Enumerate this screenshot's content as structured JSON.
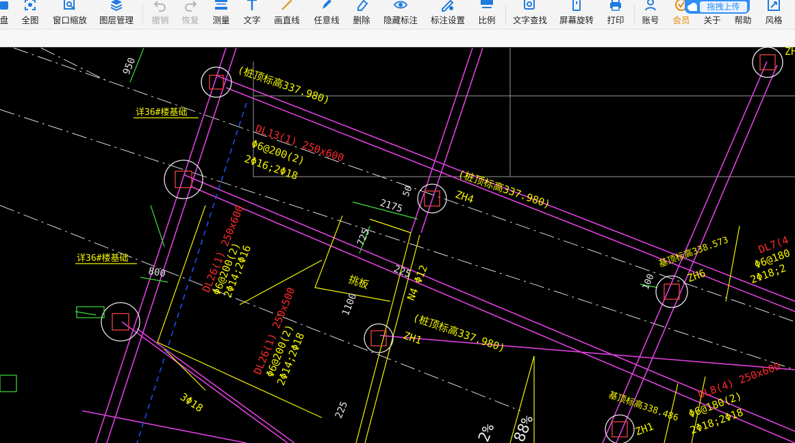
{
  "toolbar": {
    "items": [
      {
        "label": "盘",
        "icon": "disk-icon"
      },
      {
        "label": "全图",
        "icon": "full-view-icon"
      },
      {
        "label": "窗口缩放",
        "icon": "window-zoom-icon"
      },
      {
        "label": "图层管理",
        "icon": "layers-icon"
      },
      {
        "label": "撤销",
        "icon": "undo-icon"
      },
      {
        "label": "恢复",
        "icon": "redo-icon"
      },
      {
        "label": "测量",
        "icon": "measure-icon"
      },
      {
        "label": "文字",
        "icon": "text-icon"
      },
      {
        "label": "画直线",
        "icon": "line-icon"
      },
      {
        "label": "任意线",
        "icon": "freehand-icon"
      },
      {
        "label": "删除",
        "icon": "eraser-icon"
      },
      {
        "label": "隐藏标注",
        "icon": "eye-icon"
      },
      {
        "label": "标注设置",
        "icon": "annotation-settings-icon"
      },
      {
        "label": "比例",
        "icon": "scale-icon"
      },
      {
        "label": "文字查找",
        "icon": "text-search-icon"
      },
      {
        "label": "屏幕旋转",
        "icon": "rotate-icon"
      },
      {
        "label": "打印",
        "icon": "printer-icon"
      },
      {
        "label": "账号",
        "icon": "user-icon"
      },
      {
        "label": "会员",
        "icon": "vip-icon"
      },
      {
        "label": "关于",
        "icon": "about-icon"
      },
      {
        "label": "帮助",
        "icon": "help-icon"
      },
      {
        "label": "风格",
        "icon": "style-icon"
      }
    ],
    "upload_label": "拖拽上传"
  },
  "colors": {
    "accent": "#2f8df5",
    "icon_blue": "#1e7be0",
    "member": "#e58b00",
    "cad_magenta": "#e040e0",
    "cad_yellow": "#f5f500",
    "cad_red": "#ff2a2a",
    "cad_green": "#3ce03c",
    "cad_white": "#e8e8e8"
  },
  "drawing": {
    "pile_top_1": "(桩顶标高337.980)",
    "pile_top_2": "(桩顶标高337.980)",
    "pile_top_3": "(桩顶标高337.980)",
    "zh4": "ZH4",
    "zh1_a": "ZH1",
    "zh6": "ZH6",
    "zh1_b": "ZH1",
    "zh_top": "ZH",
    "beam_dl13": "DL13(1) 250x600",
    "dl13_stirrup": "Φ6@200(2)",
    "dl13_bars": "2Φ16;2Φ18",
    "beam_dl26a": "DL26(1) 250x600",
    "dl26a_stirrup": "Φ6@200(2)",
    "dl26a_bars": "2Φ14;2Φ16",
    "beam_dl26b": "DL26(1) 250x500",
    "dl26b_stirrup": "Φ6@200(2)",
    "dl26b_bars": "2Φ14;2Φ18",
    "beam_dl7": "DL7(4",
    "dl7_stirrup": "Φ6@180",
    "dl7_bars": "2Φ18;2",
    "beam_dl8": "DL8(4) 250x600",
    "dl8_stirrup": "Φ6@180(2)",
    "dl8_bars": "2Φ18;2Φ18",
    "base_elev_1": "基顶标高338.573",
    "base_elev_2": "基顶标高338.486",
    "detail_ref_1": "详36#楼基础",
    "detail_ref_2": "详36#楼基础",
    "slab": "挑板",
    "n4": "N4 Φ12",
    "three_phi18": "3Φ18",
    "dim_950": "950",
    "dim_800": "800",
    "dim_2175": "2175",
    "dim_725": "725",
    "dim_225a": "225",
    "dim_225b": "225",
    "dim_1100": "1100",
    "dim_50": "50",
    "dim_100": "100",
    "pct_2": "2%",
    "pct_88": "88%"
  }
}
